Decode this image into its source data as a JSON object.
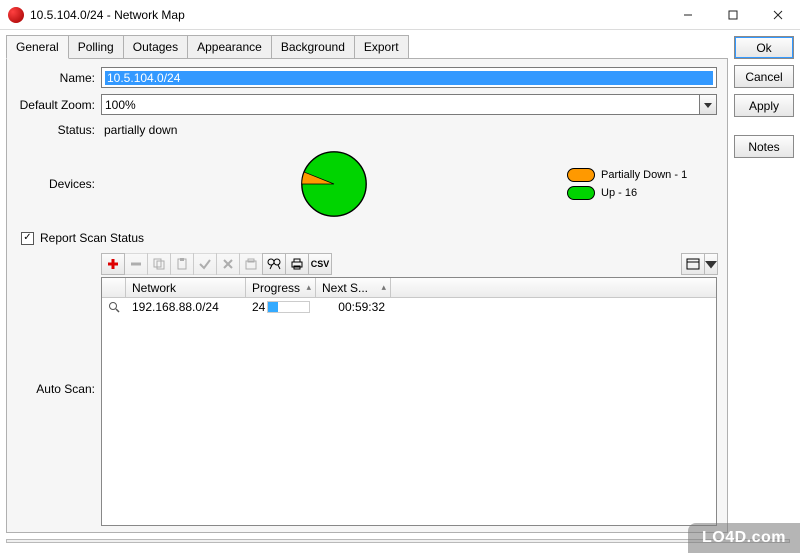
{
  "window": {
    "title": "10.5.104.0/24 - Network Map"
  },
  "tabs": [
    "General",
    "Polling",
    "Outages",
    "Appearance",
    "Background",
    "Export"
  ],
  "active_tab_index": 0,
  "form": {
    "name_label": "Name:",
    "name_value": "10.5.104.0/24",
    "zoom_label": "Default Zoom:",
    "zoom_value": "100%",
    "status_label": "Status:",
    "status_value": "partially down",
    "devices_label": "Devices:",
    "autoscan_label": "Auto Scan:",
    "report_checkbox_label": "Report Scan Status",
    "report_checked": true
  },
  "legend": {
    "partially_down": "Partially Down - 1",
    "up": "Up - 16"
  },
  "chart_data": {
    "type": "pie",
    "title": "",
    "slices": [
      {
        "name": "Partially Down",
        "value": 1,
        "color": "#ff9900"
      },
      {
        "name": "Up",
        "value": 16,
        "color": "#00d400"
      }
    ]
  },
  "listview": {
    "columns": {
      "network": "Network",
      "progress": "Progress",
      "next": "Next S..."
    },
    "rows": [
      {
        "network": "192.168.88.0/24",
        "progress_text": "24",
        "progress_pct": 24,
        "next": "00:59:32"
      }
    ]
  },
  "buttons": {
    "ok": "Ok",
    "cancel": "Cancel",
    "apply": "Apply",
    "notes": "Notes"
  },
  "toolbar_csv": "CSV",
  "watermark": "LO4D.com"
}
